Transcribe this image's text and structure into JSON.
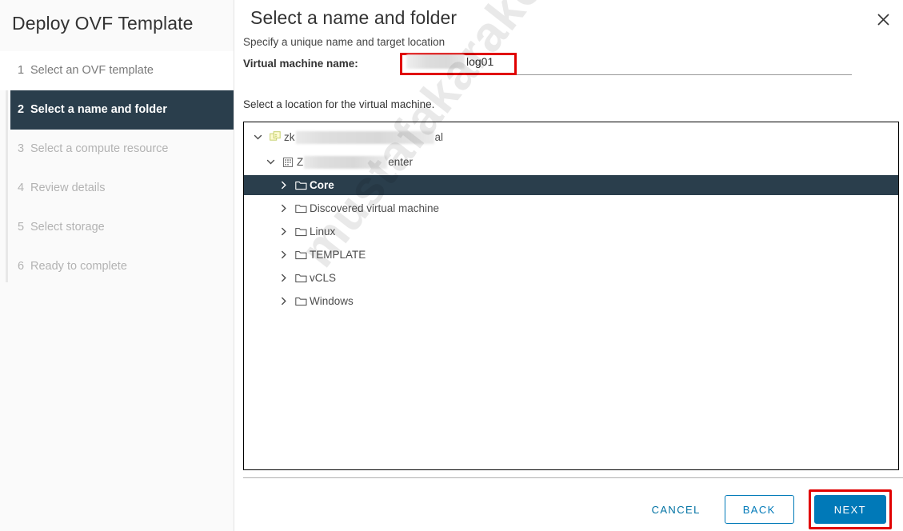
{
  "window": {
    "wizard_title": "Deploy OVF Template",
    "close_icon": "close-icon"
  },
  "sidebar": {
    "steps": [
      {
        "number": "1",
        "label": "Select an OVF template",
        "state": "done"
      },
      {
        "number": "2",
        "label": "Select a name and folder",
        "state": "current"
      },
      {
        "number": "3",
        "label": "Select a compute resource",
        "state": "upcoming"
      },
      {
        "number": "4",
        "label": "Review details",
        "state": "upcoming"
      },
      {
        "number": "5",
        "label": "Select storage",
        "state": "upcoming"
      },
      {
        "number": "6",
        "label": "Ready to complete",
        "state": "upcoming"
      }
    ]
  },
  "page": {
    "title": "Select a name and folder",
    "subtitle": "Specify a unique name and target location",
    "name_label": "Virtual machine name:",
    "name_value_visible": "log01",
    "name_value_redacted": true,
    "location_label": "Select a location for the virtual machine."
  },
  "tree": [
    {
      "label_prefix": "zk",
      "label_suffix": "al",
      "redacted": true,
      "icon": "vcenter-icon",
      "expanded": true,
      "indent": 1,
      "selected": false
    },
    {
      "label_prefix": "Z",
      "label_suffix": "enter",
      "redacted": true,
      "icon": "datacenter-icon",
      "expanded": true,
      "indent": 2,
      "selected": false
    },
    {
      "label_prefix": "Core",
      "label_suffix": "",
      "redacted": false,
      "icon": "folder-icon",
      "expanded": false,
      "indent": 3,
      "selected": true
    },
    {
      "label_prefix": "Discovered virtual machine",
      "label_suffix": "",
      "redacted": false,
      "icon": "folder-icon",
      "expanded": false,
      "indent": 3,
      "selected": false
    },
    {
      "label_prefix": "Linux",
      "label_suffix": "",
      "redacted": false,
      "icon": "folder-icon",
      "expanded": false,
      "indent": 3,
      "selected": false
    },
    {
      "label_prefix": "TEMPLATE",
      "label_suffix": "",
      "redacted": false,
      "icon": "folder-icon",
      "expanded": false,
      "indent": 3,
      "selected": false
    },
    {
      "label_prefix": "vCLS",
      "label_suffix": "",
      "redacted": false,
      "icon": "folder-icon",
      "expanded": false,
      "indent": 3,
      "selected": false
    },
    {
      "label_prefix": "Windows",
      "label_suffix": "",
      "redacted": false,
      "icon": "folder-icon",
      "expanded": false,
      "indent": 3,
      "selected": false
    }
  ],
  "footer": {
    "cancel_label": "CANCEL",
    "back_label": "BACK",
    "next_label": "NEXT",
    "next_highlighted": true
  },
  "watermark": {
    "text": "mustafakarakoyun.com"
  },
  "colors": {
    "accent_green": "#60B515",
    "dark_slate": "#2A3E4C",
    "primary_blue": "#0079B8",
    "link_blue": "#0072A3",
    "annotation_red": "#E00000",
    "sidebar_bg": "#FAFAFA"
  }
}
